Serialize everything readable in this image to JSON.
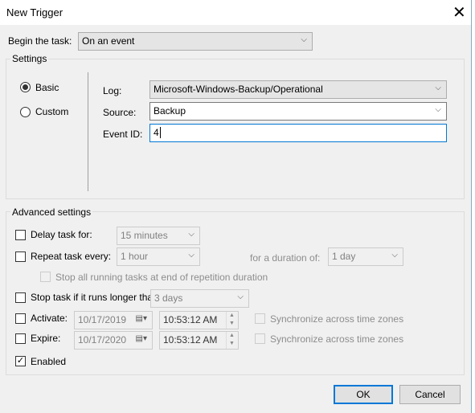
{
  "window": {
    "title": "New Trigger",
    "close_icon": "close-icon"
  },
  "begin": {
    "label": "Begin the task:",
    "value": "On an event"
  },
  "settings": {
    "legend": "Settings",
    "basic": "Basic",
    "custom": "Custom",
    "selected": "Basic",
    "log_label": "Log:",
    "log_value": "Microsoft-Windows-Backup/Operational",
    "source_label": "Source:",
    "source_value": "Backup",
    "event_id_label": "Event ID:",
    "event_id_value": "4"
  },
  "advanced": {
    "legend": "Advanced settings",
    "delay": {
      "label": "Delay task for:",
      "checked": false,
      "value": "15 minutes"
    },
    "repeat": {
      "label": "Repeat task every:",
      "checked": false,
      "value": "1 hour",
      "duration_label": "for a duration of:",
      "duration_value": "1 day"
    },
    "stop_all": {
      "label": "Stop all running tasks at end of repetition duration",
      "checked": false
    },
    "stop_longer": {
      "label": "Stop task if it runs longer than:",
      "checked": false,
      "value": "3 days"
    },
    "activate": {
      "label": "Activate:",
      "checked": false,
      "date": "10/17/2019",
      "time": "10:53:12 AM",
      "sync_label": "Synchronize across time zones"
    },
    "expire": {
      "label": "Expire:",
      "checked": false,
      "date": "10/17/2020",
      "time": "10:53:12 AM",
      "sync_label": "Synchronize across time zones"
    },
    "enabled": {
      "label": "Enabled",
      "checked": true
    }
  },
  "buttons": {
    "ok": "OK",
    "cancel": "Cancel"
  }
}
